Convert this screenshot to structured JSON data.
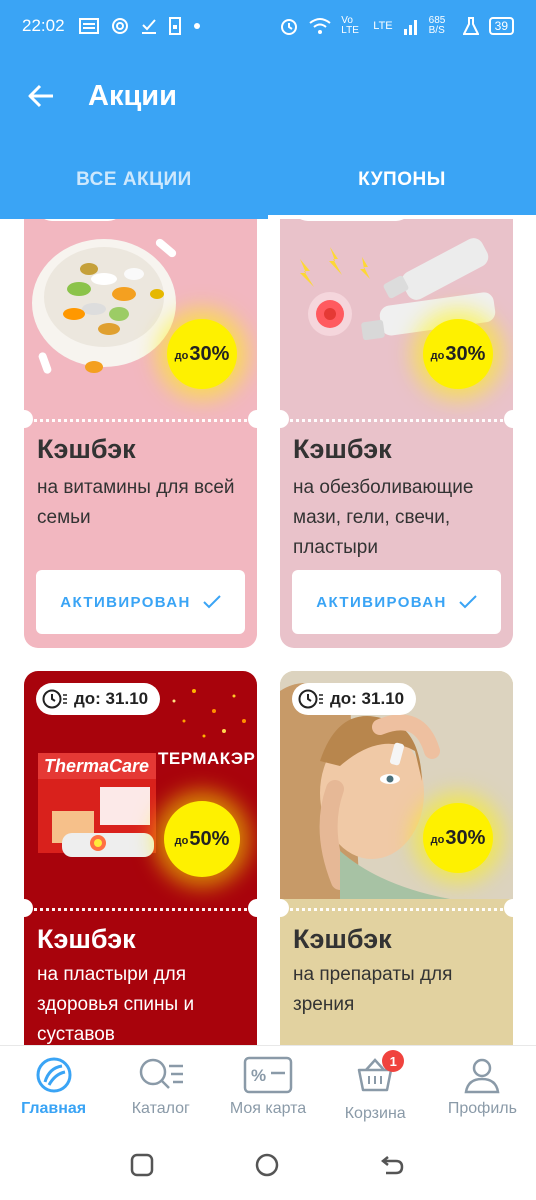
{
  "status_bar": {
    "time": "22:02",
    "network_labels": [
      "Vo LTE",
      "LTE",
      "685 B/S"
    ],
    "battery": "39"
  },
  "header": {
    "title": "Акции",
    "tabs": [
      {
        "label": "ВСЕ АКЦИИ",
        "active": false
      },
      {
        "label": "КУПОНЫ",
        "active": true
      }
    ]
  },
  "cards": [
    {
      "heading": "Кэшбэк",
      "description": "на витамины для всей семьи",
      "badge_prefix": "до",
      "badge_value": "30%",
      "button_label": "АКТИВИРОВАН",
      "bg": "#f2b7c0"
    },
    {
      "heading": "Кэшбэк",
      "description": "на обезболивающие мази, гели, свечи, пластыри",
      "badge_prefix": "до",
      "badge_value": "30%",
      "button_label": "АКТИВИРОВАН",
      "bg": "#e9c2ca"
    },
    {
      "heading": "Кэшбэк",
      "description": "на пластыри для здоровья спины и суставов",
      "date": "до: 31.10",
      "badge_prefix": "до",
      "badge_value": "50%",
      "product_label": "ТЕРМАКЭР",
      "brand_label": "ThermaCare",
      "bg": "#a8030c"
    },
    {
      "heading": "Кэшбэк",
      "description": "на препараты для зрения",
      "date": "до: 31.10",
      "badge_prefix": "до",
      "badge_value": "30%",
      "bg": "#e2d2a0"
    }
  ],
  "bottom_nav": [
    {
      "label": "Главная",
      "icon": "home-icon",
      "active": true
    },
    {
      "label": "Каталог",
      "icon": "catalog-search-icon",
      "active": false
    },
    {
      "label": "Моя карта",
      "icon": "discount-card-icon",
      "active": false
    },
    {
      "label": "Корзина",
      "icon": "basket-icon",
      "active": false,
      "badge": "1"
    },
    {
      "label": "Профиль",
      "icon": "profile-icon",
      "active": false
    }
  ],
  "colors": {
    "accent": "#3aa4f5",
    "badge_yellow": "#fef100",
    "cart_badge": "#f0433e"
  }
}
